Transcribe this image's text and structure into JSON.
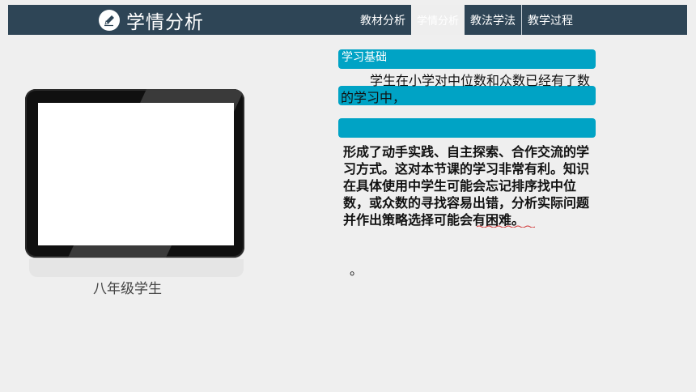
{
  "header": {
    "title": "学情分析",
    "icon": "pencil-icon",
    "tabs": [
      {
        "label": "教材分析",
        "active": false
      },
      {
        "label": "学情分析",
        "active": true
      },
      {
        "label": "教法学法",
        "active": false
      },
      {
        "label": "教学过程",
        "active": false
      }
    ]
  },
  "image_panel": {
    "caption": "八年级学生"
  },
  "content": {
    "section_label": "学习基础",
    "paragraph1": "学生在小学对中位数和众数已经有了数的学习中，",
    "paragraph2": "形成了动手实践、自主探索、合作交流的学习方式。这对本节课的学习非常有利。知识在具体使用中学生可能会忘记排序找中位数，或众数的寻找容易出错，分析实际问题并作出策略选择可能会有困难。",
    "trailing": "。"
  },
  "colors": {
    "header_bg": "#2e4556",
    "accent_bar": "#00a3c5",
    "page_bg": "#efefef"
  }
}
